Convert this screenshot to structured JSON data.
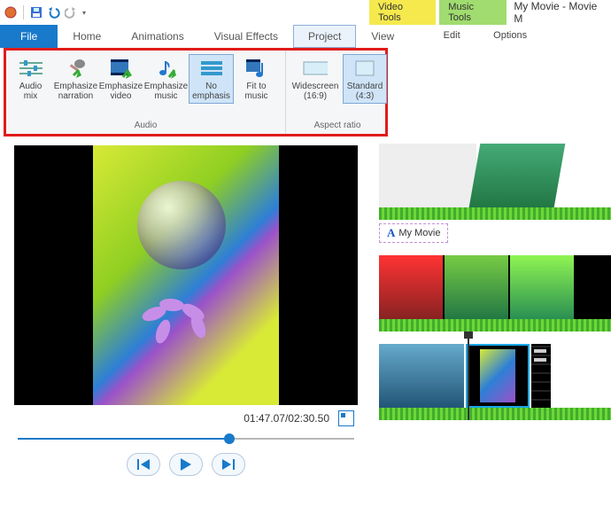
{
  "title": "My Movie - Movie M",
  "toolTabs": {
    "video": "Video Tools",
    "music": "Music Tools"
  },
  "toolSub": {
    "edit": "Edit",
    "options": "Options"
  },
  "menu": {
    "file": "File",
    "home": "Home",
    "animations": "Animations",
    "visual": "Visual Effects",
    "project": "Project",
    "view": "View"
  },
  "ribbon": {
    "audioGroup": "Audio",
    "aspectGroup": "Aspect ratio",
    "audioMix": "Audio\nmix",
    "empNarr": "Emphasize\nnarration",
    "empVideo": "Emphasize\nvideo",
    "empMusic": "Emphasize\nmusic",
    "noEmp": "No\nemphasis",
    "fitMusic": "Fit to\nmusic",
    "wide": "Widescreen\n(16:9)",
    "std": "Standard\n(4:3)"
  },
  "preview": {
    "time": "01:47.07/02:30.50"
  },
  "timeline": {
    "titleCard": "My Movie"
  }
}
